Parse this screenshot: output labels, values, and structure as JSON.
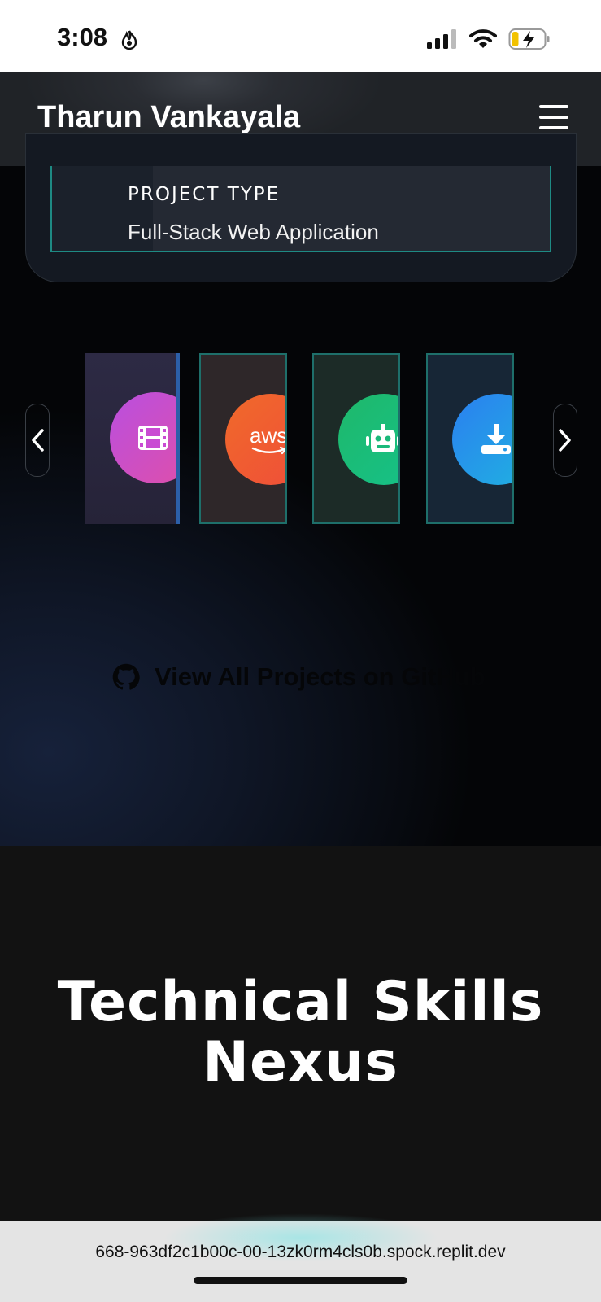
{
  "status_bar": {
    "time": "3:08",
    "icons": [
      "flame-icon",
      "signal-icon",
      "wifi-icon",
      "battery-charging-icon"
    ]
  },
  "nav": {
    "brand": "Tharun Vankayala",
    "menu_icon": "hamburger-icon"
  },
  "project_card": {
    "type_label": "PROJECT TYPE",
    "type_value": "Full-Stack Web Application"
  },
  "carousel": {
    "prev_icon": "chevron-left-icon",
    "next_icon": "chevron-right-icon",
    "items": [
      {
        "icon": "film-icon",
        "colors": [
          "#b94fe0",
          "#e04fa8"
        ]
      },
      {
        "icon": "aws-icon",
        "label": "aws",
        "colors": [
          "#f06a2a",
          "#ef4d3a"
        ]
      },
      {
        "icon": "robot-icon",
        "colors": [
          "#1fb86a",
          "#15c28a"
        ]
      },
      {
        "icon": "download-icon",
        "colors": [
          "#2b7ff0",
          "#1fb4e0"
        ]
      }
    ]
  },
  "github_link": {
    "icon": "github-icon",
    "label": "View All Projects on GitHub"
  },
  "skills": {
    "title_line1": "Technical Skills",
    "title_line2": "Nexus"
  },
  "browser": {
    "url": "668-963df2c1b00c-00-13zk0rm4cls0b.spock.replit.dev"
  }
}
